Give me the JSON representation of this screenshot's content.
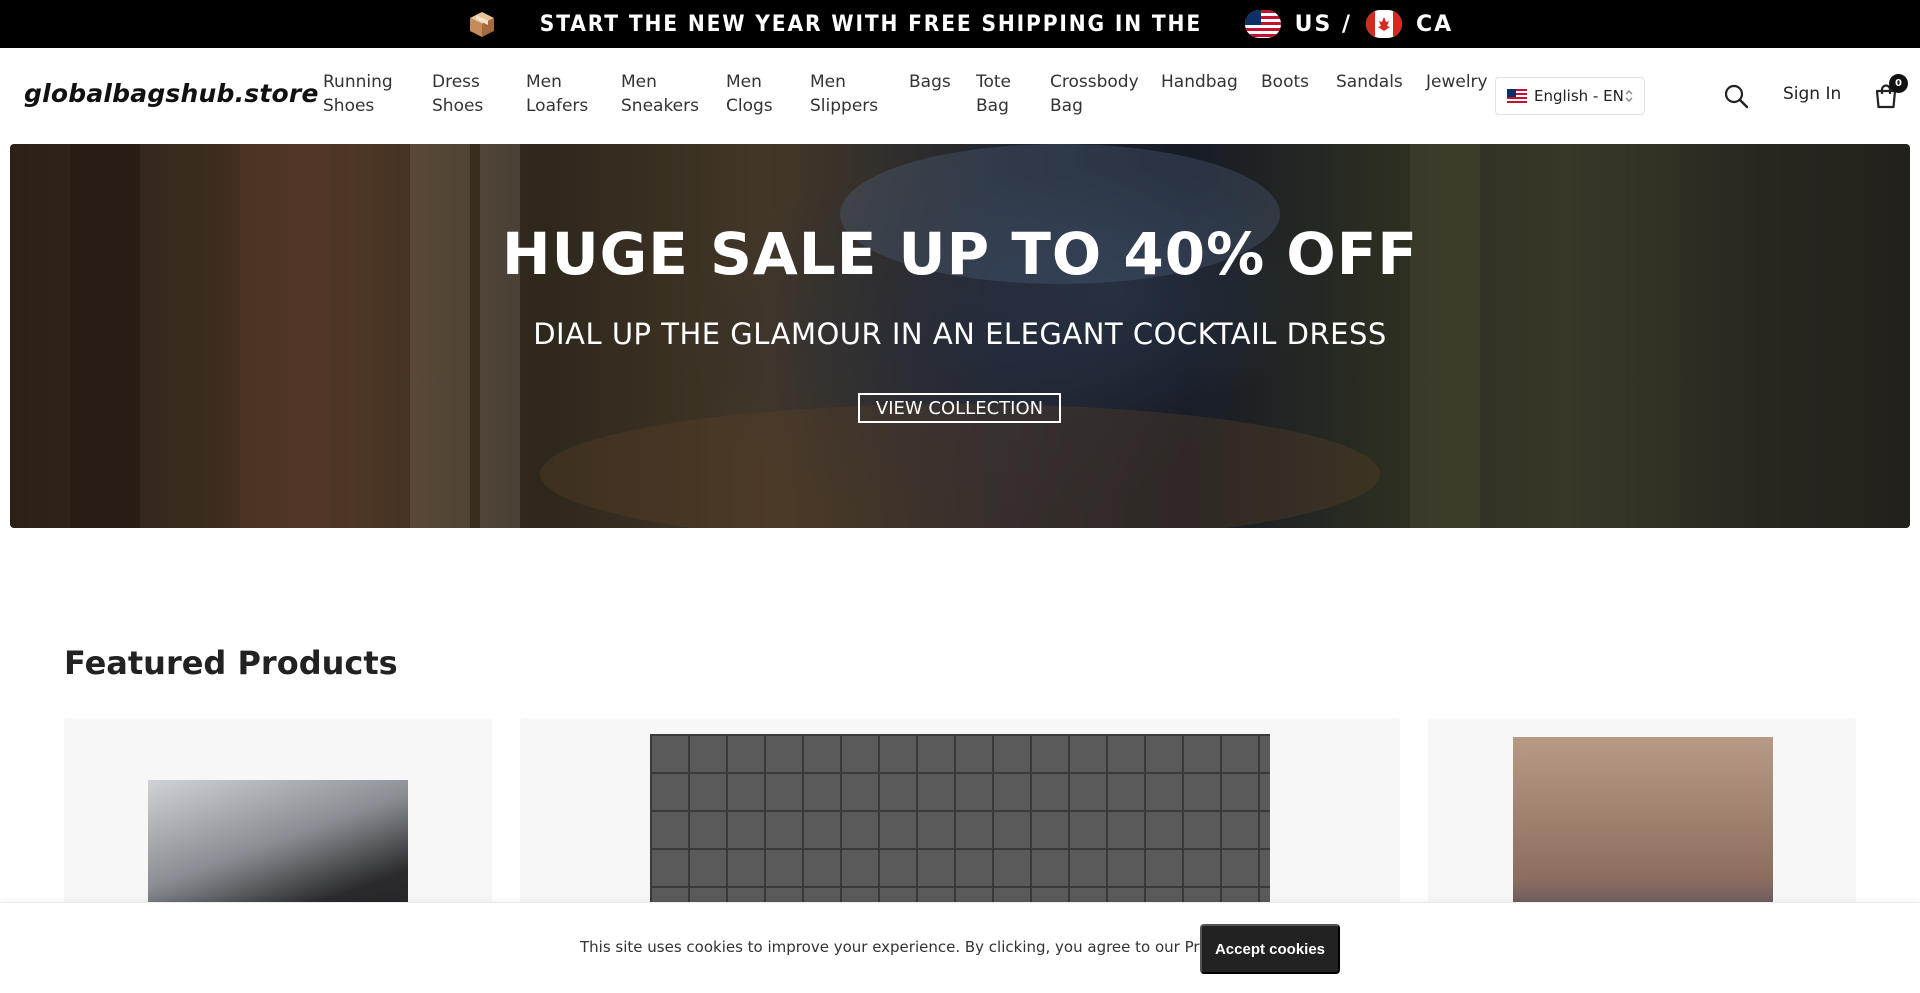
{
  "announcement": {
    "text": "START THE NEW YEAR WITH FREE SHIPPING IN THE",
    "us": "US /",
    "ca": "CA",
    "box_icon": "package-icon",
    "us_flag_icon": "us-flag-icon",
    "ca_flag_icon": "canada-flag-icon"
  },
  "header": {
    "logo": "globalbagshub.store",
    "nav": [
      {
        "label": "Running\nShoes"
      },
      {
        "label": "Dress\nShoes"
      },
      {
        "label": "Men\nLoafers"
      },
      {
        "label": "Men\nSneakers"
      },
      {
        "label": "Men\nClogs"
      },
      {
        "label": "Men\nSlippers"
      },
      {
        "label": "Bags"
      },
      {
        "label": "Tote\nBag"
      },
      {
        "label": "Crossbody\nBag"
      },
      {
        "label": "Handbag"
      },
      {
        "label": "Boots"
      },
      {
        "label": "Sandals"
      },
      {
        "label": "Jewelry"
      }
    ],
    "language": "English - EN",
    "sign_in": "Sign In",
    "cart_count": "0",
    "search_icon": "search-icon",
    "cart_icon": "shopping-bag-icon"
  },
  "hero": {
    "title": "HUGE SALE UP TO 40% OFF",
    "subtitle": "DIAL UP THE GLAMOUR IN AN ELEGANT COCKTAIL DRESS",
    "button": "VIEW COLLECTION"
  },
  "featured": {
    "title": "Featured Products"
  },
  "cookie": {
    "text": "This site uses cookies to improve your experience. By clicking, you agree to our Privacy Policy.",
    "button": "Accept cookies"
  },
  "colors": {
    "announcement_bg": "#000000",
    "cookie_button_bg": "#222222",
    "card_bg": "#f7f7f7"
  }
}
